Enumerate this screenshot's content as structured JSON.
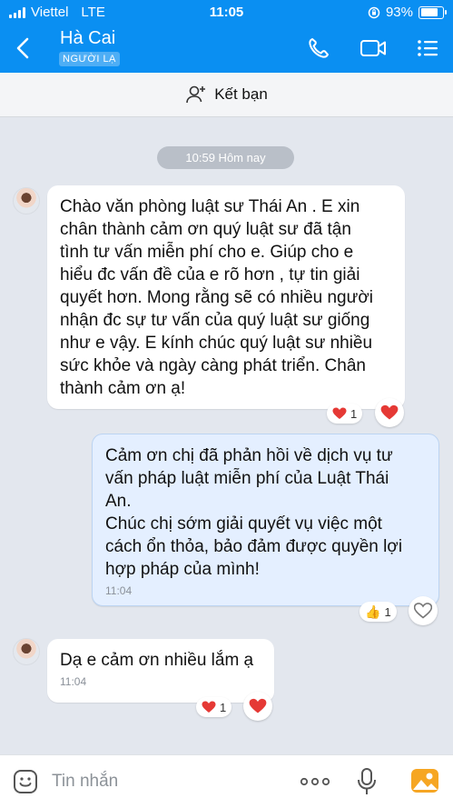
{
  "status_bar": {
    "carrier": "Viettel",
    "network": "LTE",
    "time": "11:05",
    "battery": "93%",
    "battery_level": 0.93
  },
  "header": {
    "contact_name": "Hà Cai",
    "badge": "NGƯỜI LẠ",
    "bg_color": "#0a8ff2"
  },
  "friend_bar": {
    "label": "Kết bạn"
  },
  "chat": {
    "date_divider": "10:59 Hôm nay",
    "messages": [
      {
        "direction": "incoming",
        "text": "Chào văn phòng luật sư Thái An . E xin\nchân thành cảm ơn quý luật sư đã tận\ntình tư vấn miễn phí cho e. Giúp cho e\nhiểu đc vấn đề của e rõ hơn , tự tin giải\nquyết hơn. Mong rằng sẽ có nhiều người\nnhận đc sự tư vấn của quý luật sư giống\nnhư e vậy. E kính chúc quý luật sư nhiều\nsức khỏe và ngày càng phát triển. Chân\nthành cảm ơn ạ!",
        "reaction": {
          "icon": "heart-icon",
          "count": "1"
        }
      },
      {
        "direction": "outgoing",
        "text": "Cảm ơn chị đã phản hồi về dịch vụ tư\nvấn pháp luật miễn phí của Luật Thái\nAn.\nChúc chị sớm giải quyết vụ việc một\ncách ổn thỏa, bảo đảm được quyền lợi\nhợp pháp của mình!",
        "time": "11:04",
        "reaction": {
          "icon": "thumbs-up-icon",
          "count": "1"
        }
      },
      {
        "direction": "incoming",
        "text": "Dạ e cảm ơn nhiều lắm ạ",
        "time": "11:04",
        "reaction": {
          "icon": "heart-icon",
          "count": "1"
        }
      }
    ]
  },
  "input_bar": {
    "placeholder": "Tin nhắn"
  }
}
